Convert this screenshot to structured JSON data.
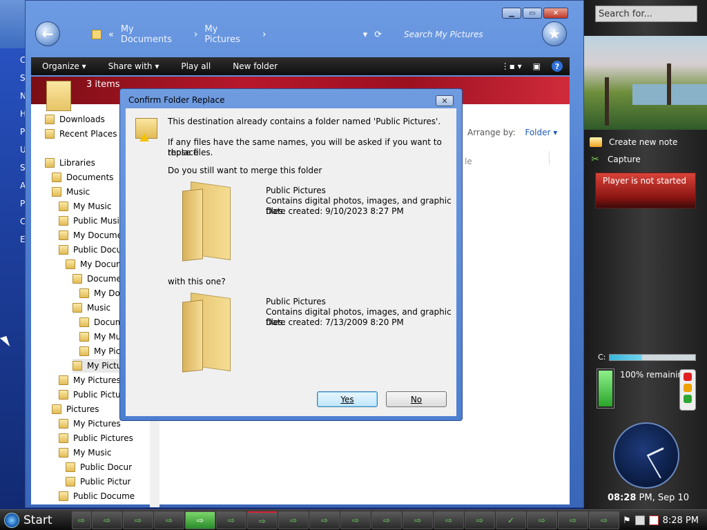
{
  "desktop": {
    "left_letters": [
      "C",
      "S",
      "N",
      "H",
      "P",
      "U",
      "S",
      "A",
      "P",
      "C",
      "E"
    ]
  },
  "explorer": {
    "breadcrumbs": [
      "My Documents",
      "My Pictures"
    ],
    "search_placeholder": "Search My Pictures",
    "toolbar": {
      "organize": "Organize",
      "share_with": "Share with",
      "play_all": "Play all",
      "new_folder": "New folder"
    },
    "item_count": "3 items",
    "arrange_by_label": "Arrange by:",
    "arrange_by_value": "Folder",
    "column_stub": "le",
    "nav_tree": [
      {
        "label": "Downloads",
        "indent": 0
      },
      {
        "label": "Recent Places",
        "indent": 0
      },
      {
        "label": "Libraries",
        "indent": 0
      },
      {
        "label": "Documents",
        "indent": 1
      },
      {
        "label": "Music",
        "indent": 1
      },
      {
        "label": "My Music",
        "indent": 2
      },
      {
        "label": "Public Music",
        "indent": 2
      },
      {
        "label": "My Documen",
        "indent": 2
      },
      {
        "label": "Public Docur",
        "indent": 2
      },
      {
        "label": "My Docum",
        "indent": 3
      },
      {
        "label": "Documen",
        "indent": 4
      },
      {
        "label": "My Doc",
        "indent": 5
      },
      {
        "label": "Music",
        "indent": 4
      },
      {
        "label": "Docum",
        "indent": 5
      },
      {
        "label": "My Mu",
        "indent": 5
      },
      {
        "label": "My Pict",
        "indent": 5
      },
      {
        "label": "My Pictu",
        "indent": 4
      },
      {
        "label": "My Pictures",
        "indent": 2
      },
      {
        "label": "Public Pictur",
        "indent": 2
      },
      {
        "label": "Pictures",
        "indent": 1
      },
      {
        "label": "My Pictures",
        "indent": 2
      },
      {
        "label": "Public Pictures",
        "indent": 2
      },
      {
        "label": "My Music",
        "indent": 2
      },
      {
        "label": "Public Docur",
        "indent": 3
      },
      {
        "label": "Public Pictur",
        "indent": 3
      },
      {
        "label": "Public Docume",
        "indent": 2
      }
    ]
  },
  "dialog": {
    "title": "Confirm Folder Replace",
    "message_line1": "This destination already contains a folder named 'Public Pictures'.",
    "message_line2a": "If any files have the same names, you will be asked if you want to replace",
    "message_line2b": "those files.",
    "question": "Do you still want to merge this folder",
    "with_this": "with this one?",
    "source": {
      "name": "Public Pictures",
      "desc": "Contains digital photos, images, and graphic files.",
      "date": "Date created: 9/10/2023 8:27 PM"
    },
    "destination": {
      "name": "Public Pictures",
      "desc": "Contains digital photos, images, and graphic files.",
      "date": "Date created: 7/13/2009 8:20 PM"
    },
    "yes_label": "Yes",
    "no_label": "No"
  },
  "sidebar": {
    "search_placeholder": "Search for...",
    "create_note": "Create new note",
    "capture": "Capture",
    "player_status": "Player is not started",
    "drive_label": "C:",
    "drive_used_fraction": 0.38,
    "battery_text": "100% remaining",
    "battery_level": 1.0,
    "clock_time": "08:28",
    "clock_suffix": " PM, Sep 10"
  },
  "taskbar": {
    "start_label": "Start",
    "tray_time": "8:28 PM"
  }
}
